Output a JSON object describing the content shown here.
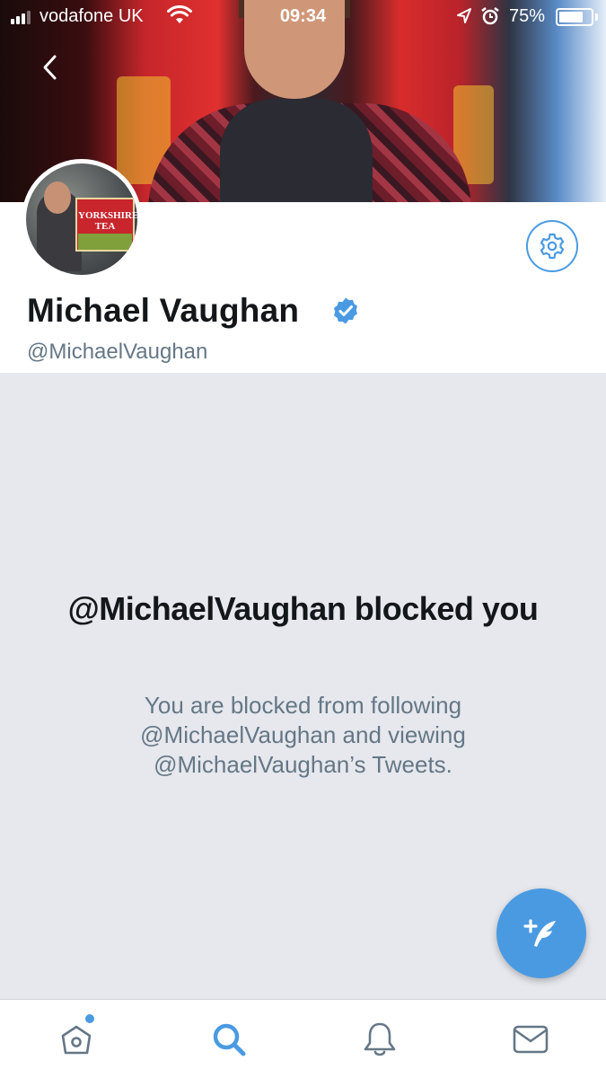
{
  "status_bar": {
    "carrier": "vodafone UK",
    "time": "09:34",
    "battery_percent": "75%",
    "battery_level": 0.75,
    "icons": [
      "signal-icon",
      "wifi-icon",
      "location-icon",
      "alarm-icon",
      "battery-icon"
    ]
  },
  "header": {
    "back_icon": "chevron-left-icon"
  },
  "profile": {
    "display_name": "Michael Vaughan",
    "verified": true,
    "handle": "@MichaelVaughan",
    "avatar_text": "YORKSHIRE TEA",
    "settings_icon": "gear-icon"
  },
  "blocked": {
    "title": "@MichaelVaughan blocked you",
    "description": "You are blocked from following @MichaelVaughan and viewing @MichaelVaughan’s Tweets."
  },
  "compose": {
    "icon": "compose-feather-icon"
  },
  "tab_bar": {
    "tabs": [
      {
        "name": "home",
        "icon": "home-icon",
        "active": false,
        "has_notification_dot": true
      },
      {
        "name": "search",
        "icon": "search-icon",
        "active": true,
        "has_notification_dot": false
      },
      {
        "name": "notifications",
        "icon": "bell-icon",
        "active": false,
        "has_notification_dot": false
      },
      {
        "name": "messages",
        "icon": "envelope-icon",
        "active": false,
        "has_notification_dot": false
      }
    ]
  },
  "colors": {
    "accent": "#4a9ae2",
    "text_primary": "#14171a",
    "text_secondary": "#657786",
    "blocked_background": "#e6e8ed"
  }
}
